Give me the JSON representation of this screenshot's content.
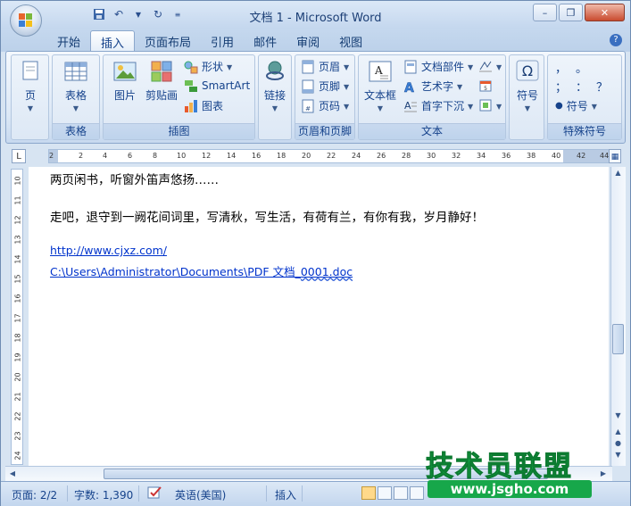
{
  "title": "文档 1 - Microsoft Word",
  "tabs": [
    "开始",
    "插入",
    "页面布局",
    "引用",
    "邮件",
    "审阅",
    "视图"
  ],
  "ribbon": {
    "page": {
      "label": "页",
      "group": ""
    },
    "table": {
      "label": "表格",
      "group": "表格"
    },
    "illustrations": {
      "picture": "图片",
      "clipart": "剪贴画",
      "shapes": "形状",
      "smartart": "SmartArt",
      "chart": "图表",
      "group": "插图"
    },
    "links": {
      "label": "链接"
    },
    "header_footer": {
      "header": "页眉",
      "footer": "页脚",
      "pagenum": "页码",
      "group": "页眉和页脚"
    },
    "text": {
      "textbox": "文本框",
      "quickparts": "文档部件",
      "wordart": "艺术字",
      "dropcap": "首字下沉",
      "group": "文本"
    },
    "symbols": {
      "symbol": "符号",
      "special_group": "特殊符号",
      "symbol_small": "符号",
      "chars": [
        "，",
        "。",
        "；",
        "：",
        "？",
        "●"
      ]
    }
  },
  "ruler": {
    "corner": "L",
    "ticks": [
      "2",
      "2",
      "4",
      "6",
      "8",
      "10",
      "12",
      "14",
      "16",
      "18",
      "20",
      "22",
      "24",
      "26",
      "28",
      "30",
      "32",
      "34",
      "36",
      "38",
      "40",
      "42",
      "44"
    ],
    "vticks": [
      "10",
      "11",
      "12",
      "13",
      "14",
      "15",
      "16",
      "17",
      "18",
      "19",
      "20",
      "21",
      "22",
      "23",
      "24"
    ]
  },
  "document": {
    "line1": "两页闲书，听窗外笛声悠扬……",
    "line2": "走吧，退守到一阙花间词里，写清秋，写生活，有荷有兰，有你有我，岁月静好！",
    "link1": "http://www.cjxz.com/",
    "link2_prefix": "C:\\Users\\Administrator\\Documents\\PDF 文档_",
    "link2_squiggle": "0001.doc"
  },
  "status": {
    "page": "页面: 2/2",
    "words": "字数: 1,390",
    "lang": "英语(美国)",
    "mode": "插入"
  },
  "watermark": {
    "text": "技术员联盟",
    "url": "www.jsgho.com"
  },
  "colors": {
    "ribbon_accent": "#15428b",
    "watermark_green": "#15b84d"
  }
}
